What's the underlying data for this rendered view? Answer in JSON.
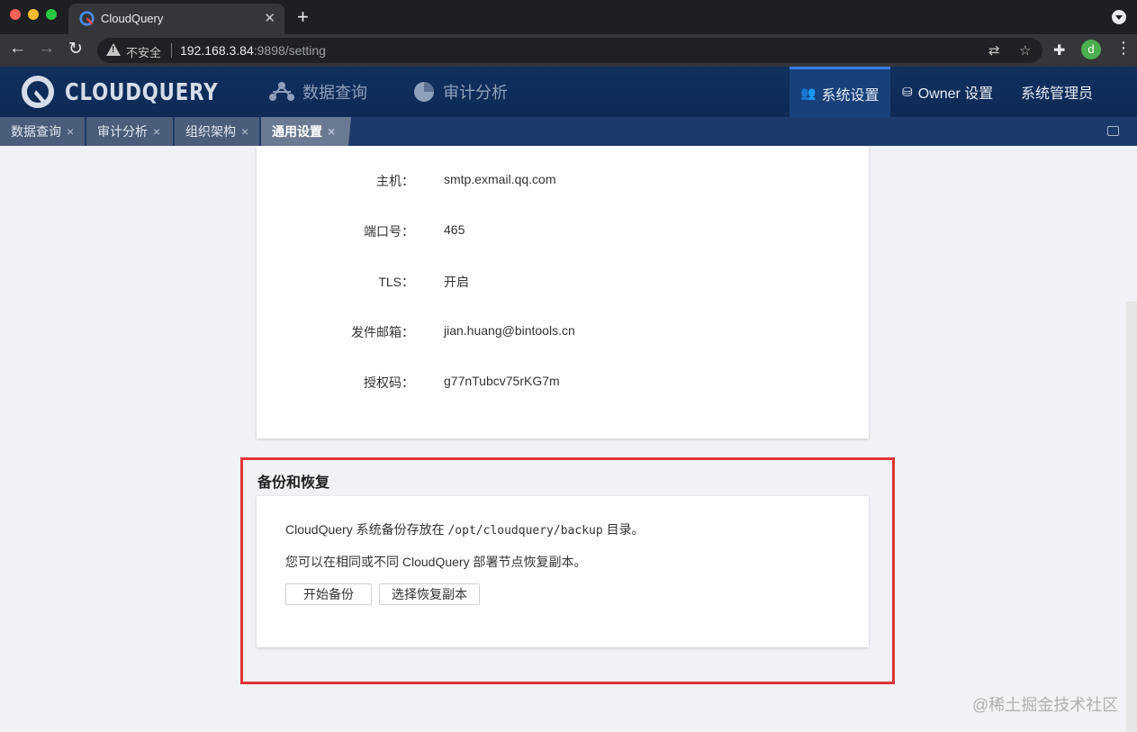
{
  "browser": {
    "tab_title": "CloudQuery",
    "tab_close": "✕",
    "new_tab": "+",
    "security_label": "不安全",
    "url_host": "192.168.3.84",
    "url_rest": ":9898/setting",
    "profile_initial": "d"
  },
  "app": {
    "logo_text": "CLOUDQUERY",
    "nav": [
      {
        "label": "数据查询",
        "icon": "network-icon"
      },
      {
        "label": "审计分析",
        "icon": "pie-chart-icon"
      }
    ],
    "nav_right": [
      {
        "label": "系统设置",
        "icon": "users-gear-icon",
        "active": true
      },
      {
        "label": "Owner 设置",
        "icon": "database-icon"
      },
      {
        "label": "系统管理员"
      }
    ],
    "page_tabs": [
      {
        "label": "数据查询"
      },
      {
        "label": "审计分析"
      },
      {
        "label": "组织架构"
      },
      {
        "label": "通用设置",
        "active": true
      }
    ],
    "tab_close_glyph": "×"
  },
  "mail_settings": {
    "rows": [
      {
        "label": "主机：",
        "value": "smtp.exmail.qq.com"
      },
      {
        "label": "端口号：",
        "value": "465"
      },
      {
        "label": "TLS：",
        "value": "开启"
      },
      {
        "label": "发件邮箱：",
        "value": "jian.huang@bintools.cn"
      },
      {
        "label": "授权码：",
        "value": "g77nTubcv75rKG7m"
      }
    ]
  },
  "backup": {
    "title": "备份和恢复",
    "line1_prefix": "CloudQuery 系统备份存放在",
    "line1_path": "/opt/cloudquery/backup",
    "line1_suffix": "目录。",
    "line2": "您可以在相同或不同 CloudQuery 部署节点恢复副本。",
    "start_button": "开始备份",
    "restore_button": "选择恢复副本"
  },
  "watermark": "@稀土掘金技术社区",
  "colors": {
    "header_bg": "#10305f",
    "highlight_border": "#e03535",
    "active_nav_bg": "#17417a"
  }
}
